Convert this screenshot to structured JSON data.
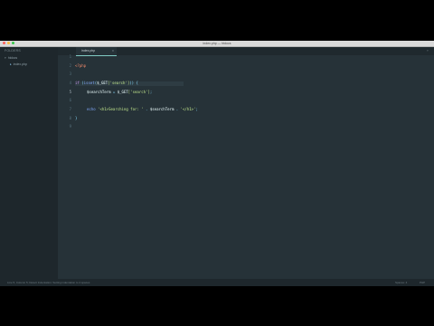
{
  "window": {
    "title": "index.php — htdocs"
  },
  "sidebar": {
    "header": "FOLDERS",
    "folder": {
      "name": "htdocs",
      "arrow": "▾"
    },
    "files": [
      {
        "name": "index.php",
        "bullet": "▸"
      }
    ]
  },
  "tabs": [
    {
      "label": "index.php",
      "close": "×"
    }
  ],
  "tab_overflow": "▾",
  "editor": {
    "line_numbers": [
      "1",
      "2",
      "3",
      "4",
      "5",
      "6",
      "7",
      "8",
      "9"
    ],
    "active_line": "5",
    "lines": {
      "l1": {
        "php_open": "<?php"
      },
      "l3": {
        "if": "if",
        "open": " (",
        "isset": "isset",
        "p1": "(",
        "get": "$_GET",
        "key": "['search']",
        "close": ")) {"
      },
      "l4": {
        "var": "$searchTerm",
        "eq": " = ",
        "get": "$_GET",
        "key": "['search']",
        "semi": ";"
      },
      "l6": {
        "echo": "echo",
        "s1": " '<h1>Searching for: '",
        "dot1": " . ",
        "var": "$searchTerm",
        "dot2": " . ",
        "s2": "'</h1>'",
        "semi": ";"
      },
      "l7": {
        "close": "}"
      }
    }
  },
  "statusbar": {
    "left": "Line 5, Column 5; Detect Indentation: Setting indentation to 4 spaces",
    "spaces": "Spaces: 4",
    "syntax": "PHP"
  }
}
